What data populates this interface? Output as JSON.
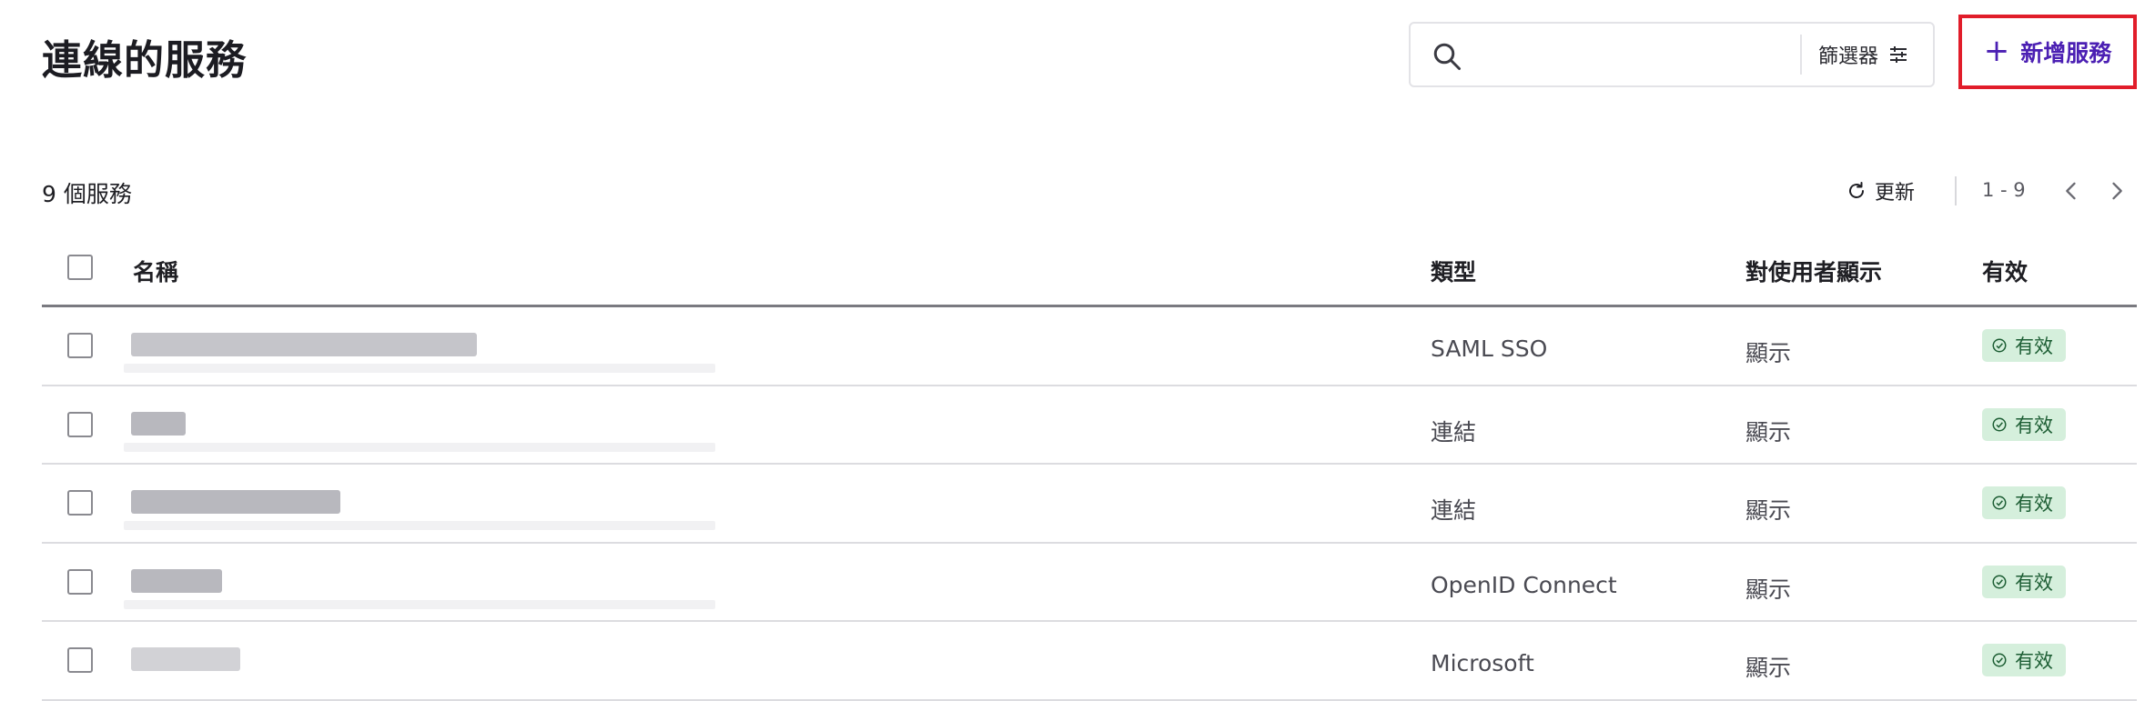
{
  "header": {
    "title": "連線的服務",
    "search": {
      "value": "",
      "placeholder": ""
    },
    "filter_label": "篩選器",
    "add_service_label": "新增服務"
  },
  "toolbar": {
    "count_text": "9 個服務",
    "refresh_label": "更新",
    "range_text": "1 - 9"
  },
  "table": {
    "columns": {
      "name": "名稱",
      "type": "類型",
      "visible": "對使用者顯示",
      "active": "有效"
    },
    "rows": [
      {
        "type": "SAML SSO",
        "visible": "顯示",
        "status": "有效"
      },
      {
        "type": "連結",
        "visible": "顯示",
        "status": "有效"
      },
      {
        "type": "連結",
        "visible": "顯示",
        "status": "有效"
      },
      {
        "type": "OpenID Connect",
        "visible": "顯示",
        "status": "有效"
      },
      {
        "type": "Microsoft",
        "visible": "顯示",
        "status": "有效"
      }
    ]
  },
  "colors": {
    "accent": "#4b1fb3",
    "highlight_border": "#e11d2a",
    "badge_bg": "#d5efdc",
    "badge_text": "#1d5e34"
  },
  "icons": [
    "search-icon",
    "filter-sliders-icon",
    "plus-icon",
    "refresh-icon",
    "chevron-left-icon",
    "chevron-right-icon",
    "check-circle-icon"
  ]
}
